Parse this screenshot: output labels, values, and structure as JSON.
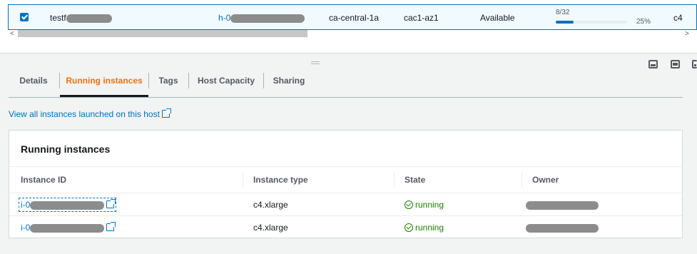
{
  "host_row": {
    "name_prefix": "testf",
    "host_id_prefix": "h-0",
    "availability_zone": "ca-central-1a",
    "zone_id": "cac1-az1",
    "state": "Available",
    "capacity_label": "8/32",
    "capacity_fraction": 0.25,
    "capacity_percent": "25%",
    "instance_family": "c4",
    "selected": true
  },
  "tabs": [
    {
      "label": "Details"
    },
    {
      "label": "Running instances",
      "active": true
    },
    {
      "label": "Tags"
    },
    {
      "label": "Host Capacity"
    },
    {
      "label": "Sharing"
    }
  ],
  "view_all_link": "View all instances launched on this host",
  "running_instances": {
    "title": "Running instances",
    "columns": [
      "Instance ID",
      "Instance type",
      "State",
      "Owner"
    ],
    "rows": [
      {
        "id_prefix": "i-0",
        "type": "c4.xlarge",
        "state": "running"
      },
      {
        "id_prefix": "i-0",
        "type": "c4.xlarge",
        "state": "running"
      }
    ]
  },
  "colors": {
    "link": "#0073bb",
    "active_tab": "#ec7211",
    "running": "#1d8102"
  },
  "icons": {
    "external": "external-link-icon",
    "status": "status-check-icon",
    "checkbox": "checkbox-checked-icon"
  }
}
